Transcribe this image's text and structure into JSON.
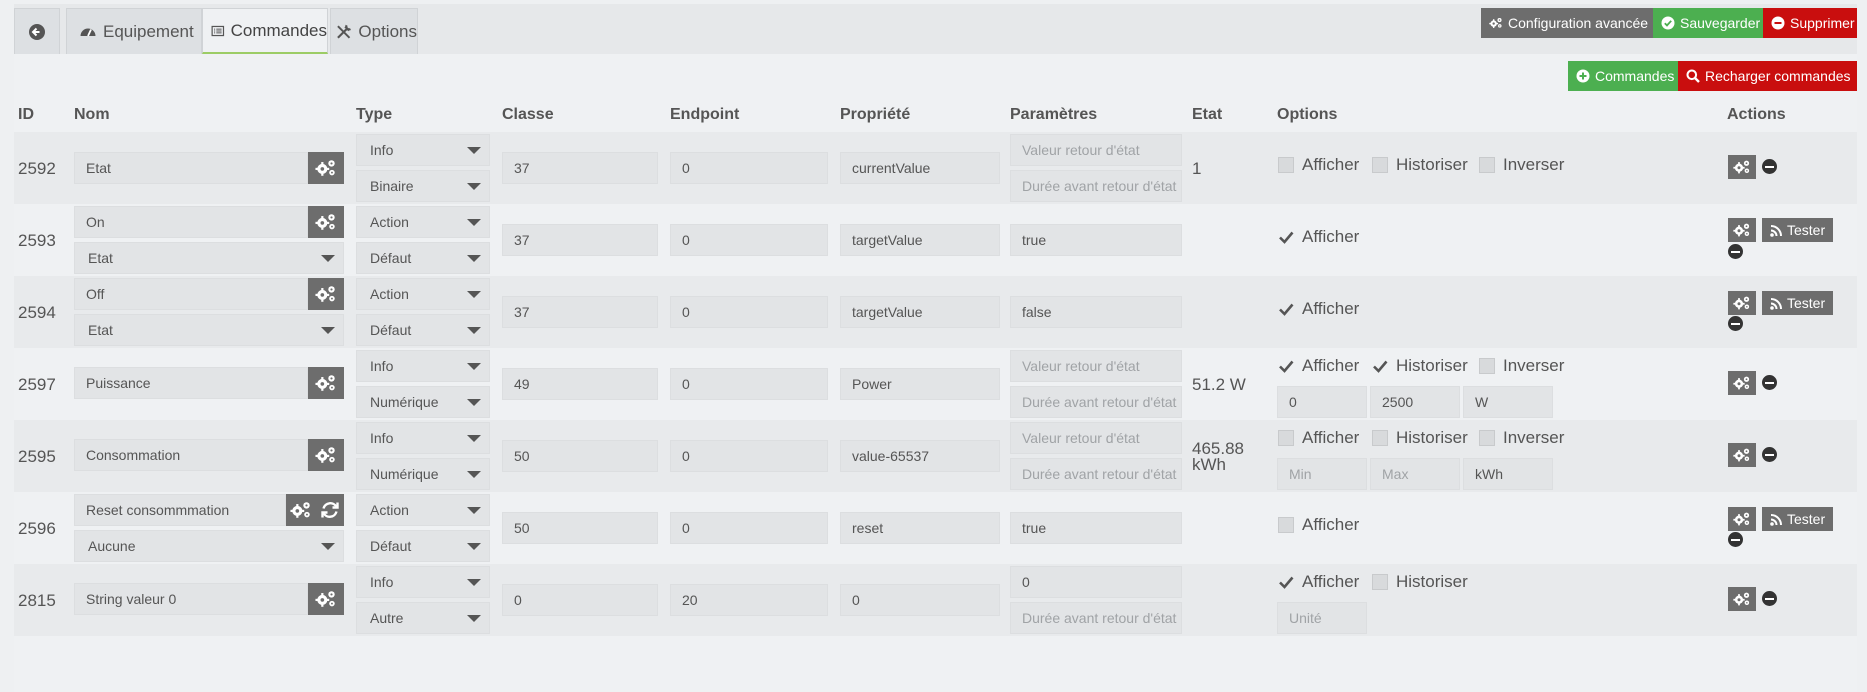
{
  "tabs": {
    "equipement": "Equipement",
    "commandes": "Commandes",
    "options": "Options"
  },
  "top_buttons": {
    "config": "Configuration avancée",
    "save": "Sauvegarder",
    "delete": "Supprimer"
  },
  "table_buttons": {
    "add": "Commandes",
    "reload": "Recharger commandes"
  },
  "columns": {
    "id": "ID",
    "nom": "Nom",
    "type": "Type",
    "classe": "Classe",
    "endpoint": "Endpoint",
    "propriete": "Propriété",
    "parametres": "Paramètres",
    "etat": "Etat",
    "options": "Options",
    "actions": "Actions"
  },
  "labels": {
    "afficher": "Afficher",
    "historiser": "Historiser",
    "inverser": "Inverser",
    "tester": "Tester"
  },
  "placeholders": {
    "retour": "Valeur retour d'état",
    "duree": "Durée avant retour d'état",
    "min": "Min",
    "max": "Max",
    "unite": "Unité"
  },
  "colors": {
    "green": "#4caf50",
    "red": "#c90e0e",
    "grey": "#6d6d6d"
  },
  "rows": [
    {
      "id": "2592",
      "name": "Etat",
      "type": "Info",
      "subtype": "Binaire",
      "classe": "37",
      "endpoint": "0",
      "propriete": "currentValue",
      "etat": "1",
      "afficher": false,
      "historiser": false,
      "inverser": false
    },
    {
      "id": "2593",
      "name": "On",
      "value_select": "Etat",
      "type": "Action",
      "subtype": "Défaut",
      "classe": "37",
      "endpoint": "0",
      "propriete": "targetValue",
      "param": "true",
      "afficher": true
    },
    {
      "id": "2594",
      "name": "Off",
      "value_select": "Etat",
      "type": "Action",
      "subtype": "Défaut",
      "classe": "37",
      "endpoint": "0",
      "propriete": "targetValue",
      "param": "false",
      "afficher": true
    },
    {
      "id": "2597",
      "name": "Puissance",
      "type": "Info",
      "subtype": "Numérique",
      "classe": "49",
      "endpoint": "0",
      "propriete": "Power",
      "etat": "51.2 W",
      "afficher": true,
      "historiser": true,
      "inverser": false,
      "min": "0",
      "max": "2500",
      "unit": "W"
    },
    {
      "id": "2595",
      "name": "Consommation",
      "type": "Info",
      "subtype": "Numérique",
      "classe": "50",
      "endpoint": "0",
      "propriete": "value-65537",
      "etat_line1": "465.88",
      "etat_line2": "kWh",
      "afficher": false,
      "historiser": false,
      "inverser": false,
      "unit": "kWh"
    },
    {
      "id": "2596",
      "name": "Reset consommmation",
      "value_select": "Aucune",
      "type": "Action",
      "subtype": "Défaut",
      "classe": "50",
      "endpoint": "0",
      "propriete": "reset",
      "param": "true",
      "afficher": false
    },
    {
      "id": "2815",
      "name": "String valeur 0",
      "type": "Info",
      "subtype": "Autre",
      "classe": "0",
      "endpoint": "20",
      "propriete": "0",
      "param": "0",
      "afficher": true,
      "historiser": false
    }
  ]
}
